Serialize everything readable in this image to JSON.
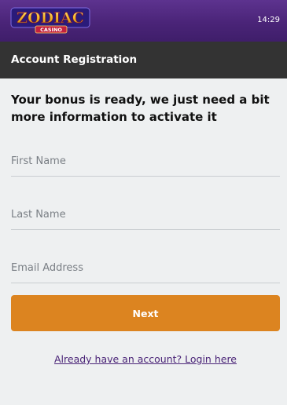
{
  "header": {
    "logo_word": "ZODIAC",
    "logo_sub": "CASINO",
    "time": "14:29",
    "title": "Account Registration"
  },
  "form": {
    "heading": "Your bonus is ready, we just need a bit more information to activate it",
    "first_name_placeholder": "First Name",
    "first_name_value": "",
    "last_name_placeholder": "Last Name",
    "last_name_value": "",
    "email_placeholder": "Email Address",
    "email_value": "",
    "next_label": "Next",
    "login_link": "Already have an account? Login here"
  },
  "colors": {
    "header_purple": "#4a2478",
    "title_bar": "#333333",
    "page_background": "#eef0f1",
    "button_orange": "#dc8420",
    "link_purple": "#4a2477"
  }
}
